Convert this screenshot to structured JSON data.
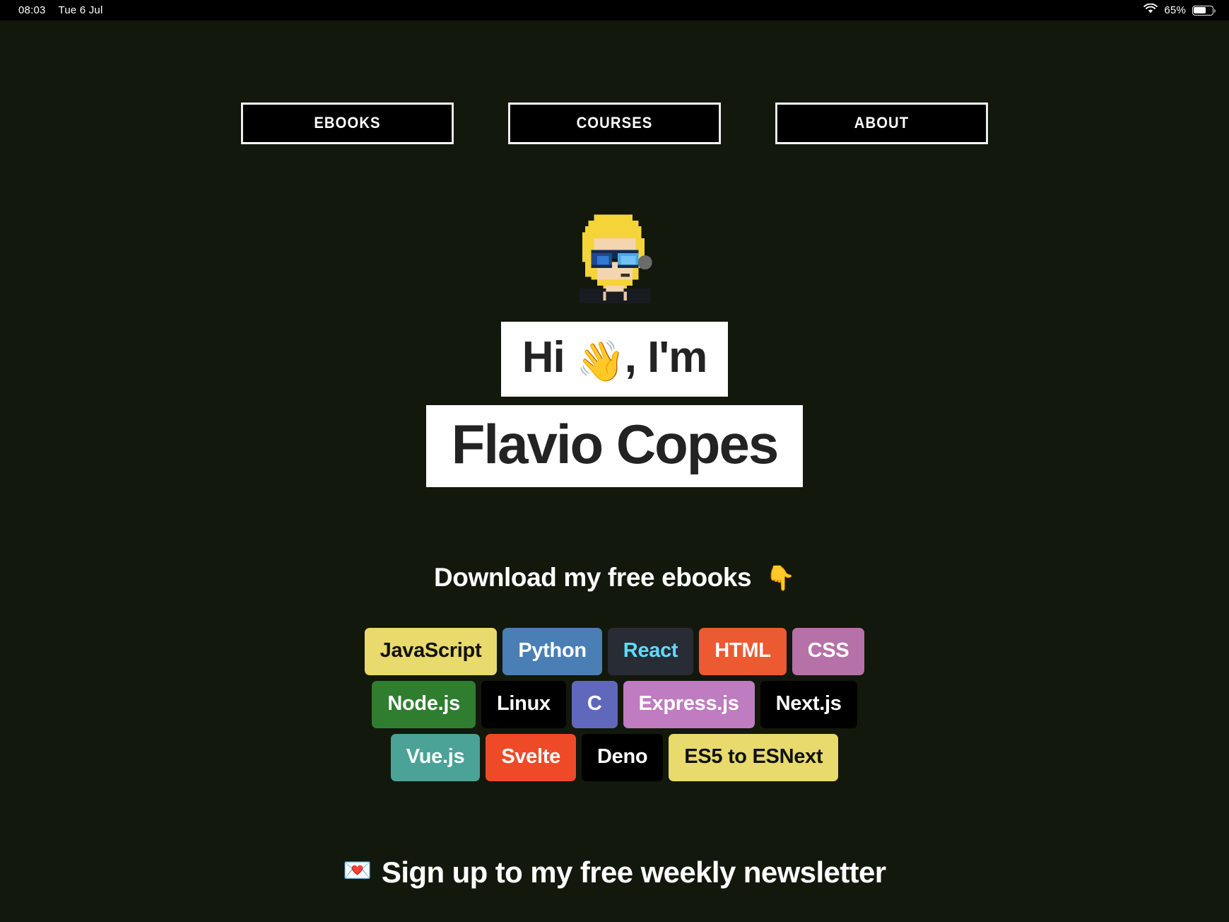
{
  "status_bar": {
    "time": "08:03",
    "date": "Tue 6 Jul",
    "battery_percent": "65%",
    "battery_level": 65,
    "wifi_icon": "wifi-icon",
    "battery_icon": "battery-icon"
  },
  "nav": {
    "items": [
      {
        "label": "EBOOKS"
      },
      {
        "label": "COURSES"
      },
      {
        "label": "ABOUT"
      }
    ]
  },
  "hero": {
    "avatar_alt": "pixel-art-avatar",
    "greeting": "Hi",
    "wave_emoji": "👋",
    "greeting_suffix": ", I'm",
    "name": "Flavio Copes"
  },
  "download": {
    "text": "Download my free ebooks",
    "point_emoji": "👇"
  },
  "ebooks": {
    "rows": [
      [
        {
          "label": "JavaScript",
          "bg": "#e8da6d",
          "fg": "#111111"
        },
        {
          "label": "Python",
          "bg": "#4a7fb5",
          "fg": "#ffffff"
        },
        {
          "label": "React",
          "bg": "#282c34",
          "fg": "#61dafb"
        },
        {
          "label": "HTML",
          "bg": "#ec5a31",
          "fg": "#ffffff"
        },
        {
          "label": "CSS",
          "bg": "#b571a8",
          "fg": "#ffffff"
        }
      ],
      [
        {
          "label": "Node.js",
          "bg": "#2f7d2f",
          "fg": "#ffffff"
        },
        {
          "label": "Linux",
          "bg": "#000000",
          "fg": "#ffffff"
        },
        {
          "label": "C",
          "bg": "#6068bb",
          "fg": "#ffffff"
        },
        {
          "label": "Express.js",
          "bg": "#c07cc0",
          "fg": "#ffffff"
        },
        {
          "label": "Next.js",
          "bg": "#000000",
          "fg": "#ffffff"
        }
      ],
      [
        {
          "label": "Vue.js",
          "bg": "#4aa396",
          "fg": "#ffffff"
        },
        {
          "label": "Svelte",
          "bg": "#ee4a28",
          "fg": "#ffffff"
        },
        {
          "label": "Deno",
          "bg": "#000000",
          "fg": "#ffffff"
        },
        {
          "label": "ES5 to ESNext",
          "bg": "#e8da6d",
          "fg": "#111111"
        }
      ]
    ]
  },
  "newsletter": {
    "mail_emoji": "💌",
    "text": "Sign up to my free weekly newsletter"
  },
  "theme": {
    "background": "#12180c",
    "highlight_bg": "#ffffff",
    "highlight_fg": "#232323",
    "text": "#ffffff"
  }
}
